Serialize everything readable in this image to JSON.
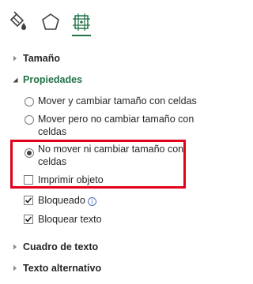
{
  "tabs": [
    {
      "name": "fill-line",
      "icon": "paint-bucket-icon"
    },
    {
      "name": "effects",
      "icon": "pentagon-icon"
    },
    {
      "name": "size-properties",
      "icon": "size-properties-icon",
      "selected": true
    }
  ],
  "accent_color": "#217346",
  "highlight_color": "#e3001b",
  "sections": {
    "size": {
      "title": "Tamaño",
      "expanded": false
    },
    "properties": {
      "title": "Propiedades",
      "expanded": true
    },
    "text_box": {
      "title": "Cuadro de texto",
      "expanded": false
    },
    "alt_text": {
      "title": "Texto alternativo",
      "expanded": false
    }
  },
  "properties": {
    "move_resize": {
      "label": "Mover y cambiar tamaño con celdas",
      "checked": false
    },
    "move_no_resize": {
      "line1": "Mover pero no cambiar tamaño con",
      "line2": "celdas",
      "checked": false
    },
    "no_move_no_resize": {
      "line1": "No mover ni cambiar tamaño con",
      "line2": "celdas",
      "checked": true
    },
    "print_object": {
      "label": "Imprimir objeto",
      "checked": false
    },
    "locked": {
      "label": "Bloqueado",
      "checked": true
    },
    "lock_text": {
      "label": "Bloquear texto",
      "checked": true
    }
  }
}
